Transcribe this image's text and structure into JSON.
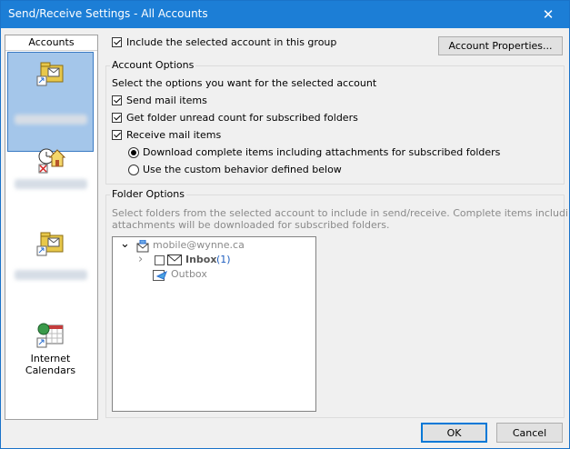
{
  "window": {
    "title": "Send/Receive Settings - All Accounts",
    "close_glyph": "✕"
  },
  "sidebar": {
    "header": "Accounts",
    "accounts": [
      {
        "icon": "account-folder-icon",
        "label": ""
      },
      {
        "icon": "schedule-house-icon",
        "label": ""
      },
      {
        "icon": "account-folder-icon",
        "label": ""
      },
      {
        "icon": "internet-calendar-icon",
        "label": "Internet Calendars"
      }
    ]
  },
  "include_account": {
    "label": "Include the selected account in this group",
    "checked": true
  },
  "account_properties_button": "Account Properties...",
  "account_options": {
    "title": "Account Options",
    "prompt": "Select the options you want for the selected account",
    "send_mail": {
      "label": "Send mail items",
      "checked": true
    },
    "unread_count": {
      "label": "Get folder unread count for subscribed folders",
      "checked": true
    },
    "receive_mail": {
      "label": "Receive mail items",
      "checked": true
    },
    "download_complete": {
      "label": "Download complete items including attachments for subscribed folders",
      "selected": true
    },
    "custom_behavior": {
      "label": "Use the custom behavior defined below",
      "selected": false
    }
  },
  "folder_options": {
    "title": "Folder Options",
    "description_line1": "Select folders from the selected account to include in send/receive. Complete items including",
    "description_line2": "attachments will be downloaded for subscribed folders.",
    "tree": {
      "account": "mobile@wynne.ca",
      "expand_glyph": "⌄",
      "inbox": {
        "name": "Inbox",
        "count": "(1)",
        "checked": false
      },
      "outbox": {
        "name": "Outbox"
      },
      "collapse_glyph": "›"
    }
  },
  "buttons": {
    "ok": "OK",
    "cancel": "Cancel"
  },
  "colors": {
    "titlebar": "#1c7ed6",
    "selection": "#a4c6ea",
    "count_blue": "#1f5fbf"
  }
}
